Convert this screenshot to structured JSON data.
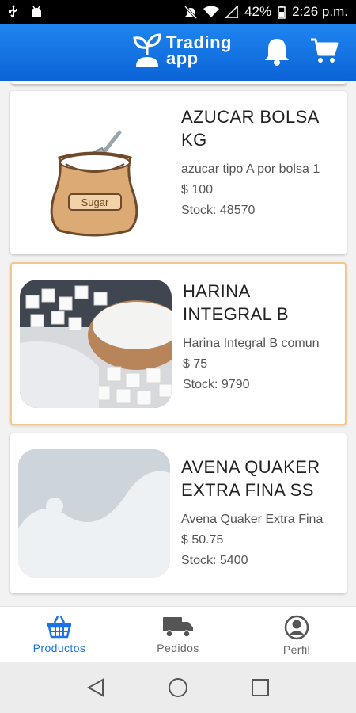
{
  "status_bar": {
    "battery": "42%",
    "time": "2:26 p.m.",
    "icons": [
      "usb-icon",
      "android-debug-icon",
      "mute-icon",
      "wifi-icon",
      "signal-icon",
      "battery-icon"
    ]
  },
  "app_bar": {
    "logo_line1": "Trading",
    "logo_line2": "app",
    "icons": [
      "notifications-bell-icon",
      "shopping-cart-icon"
    ],
    "color": "#0b63d6"
  },
  "products": [
    {
      "name": "AZUCAR BOLSA KG",
      "description": "azucar tipo A por bolsa 1",
      "price": "$ 100",
      "stock": "Stock: 48570",
      "image_text": "Sugar"
    },
    {
      "name": "HARINA INTEGRAL B",
      "description": "Harina Integral B comun",
      "price": "$ 75",
      "stock": "Stock: 9790"
    },
    {
      "name": "AVENA QUAKER EXTRA FINA SS",
      "description": "Avena Quaker Extra Fina",
      "price": "$ 50.75",
      "stock": "Stock: 5400"
    }
  ],
  "bottom_nav": [
    {
      "label": "Productos",
      "icon": "basket-icon",
      "active": true
    },
    {
      "label": "Pedidos",
      "icon": "truck-icon",
      "active": false
    },
    {
      "label": "Perfil",
      "icon": "profile-icon",
      "active": false
    }
  ],
  "system_nav": [
    "back-icon",
    "home-icon",
    "recents-icon"
  ],
  "colors": {
    "accent": "#1a73e8",
    "selected_border": "#f3c88e"
  }
}
